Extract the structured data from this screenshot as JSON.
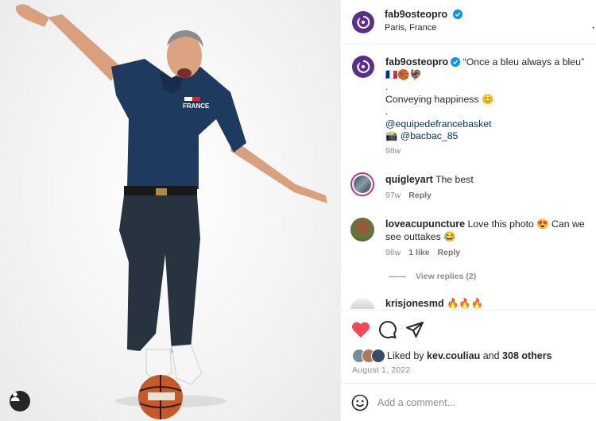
{
  "post": {
    "author": "fab9osteopro",
    "location": "Paris, France",
    "caption": {
      "username": "fab9osteopro",
      "text": "“Once a bleu always a bleu”",
      "line2": "🇫🇷🏀🦃",
      "dot1": ".",
      "line3": "Conveying happiness 😊",
      "dot2": ".",
      "mention1": "@equipedefrancebasket",
      "camera": "📸",
      "mention2": "@bacbac_85",
      "time": "98w"
    }
  },
  "comments": [
    {
      "username": "quigleyart",
      "text": "The best",
      "time": "97w",
      "reply": "Reply"
    },
    {
      "username": "loveacupuncture",
      "text": "Love this photo 😍 Can we see outtakes 😂",
      "time": "98w",
      "likes": "1 like",
      "reply": "Reply",
      "view_replies": "View replies (2)"
    },
    {
      "username": "krisjonesmd",
      "text": "🔥🔥🔥"
    }
  ],
  "likes": {
    "prefix": "Liked by",
    "user": "kev.couliau",
    "and": "and",
    "others": "308 others"
  },
  "date": "August 1, 2022",
  "composer": {
    "placeholder": "Add a comment..."
  },
  "colors": {
    "heart": "#ed4956",
    "verified": "#0095f6",
    "brand_avatar": "#5b2e8a",
    "link": "#00376b",
    "shirt": "#1f3a5f"
  }
}
